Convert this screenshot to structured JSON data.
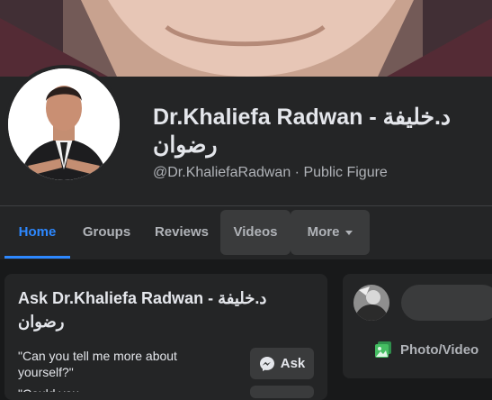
{
  "header": {
    "title": "Dr.Khaliefa Radwan - د.خليفة رضوان",
    "username": "@Dr.KhaliefaRadwan",
    "separator": " · ",
    "category": "Public Figure"
  },
  "tabs": [
    {
      "label": "Home"
    },
    {
      "label": "Groups"
    },
    {
      "label": "Reviews"
    },
    {
      "label": "Videos"
    },
    {
      "label": "More"
    }
  ],
  "ask_card": {
    "title": "Ask Dr.Khaliefa Radwan - د.خليفة رضوان",
    "questions": [
      {
        "text": "\"Can you tell me more about yourself?\"",
        "button": "Ask"
      },
      {
        "text": "\"Could you... ",
        "button": ""
      }
    ]
  },
  "composer": {
    "photo_video_label": "Photo/Video"
  },
  "colors": {
    "accent": "#2d88ff",
    "background": "#18191a",
    "panel": "#242526",
    "photo_icon": "#45bd62"
  }
}
